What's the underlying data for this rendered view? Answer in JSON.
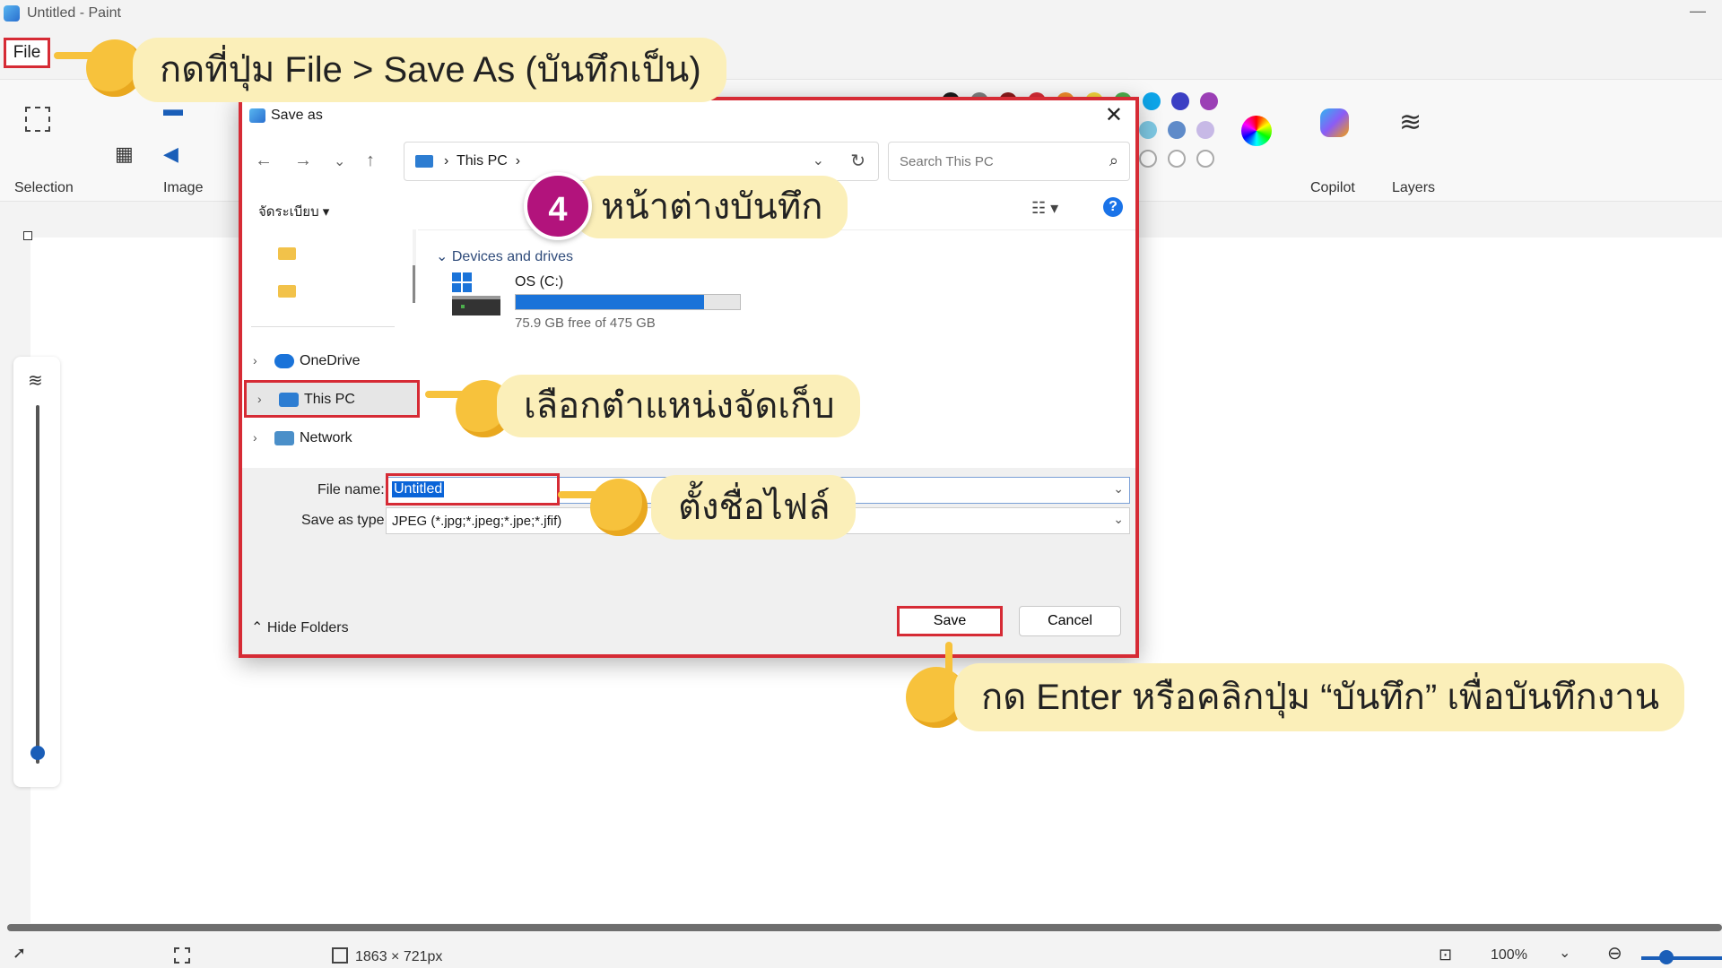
{
  "window": {
    "title": "Untitled - Paint",
    "minimize": "—"
  },
  "menu": {
    "file": "File"
  },
  "ribbon": {
    "groups": {
      "selection": "Selection",
      "image": "Image",
      "copilot": "Copilot",
      "layers": "Layers"
    },
    "swatches": [
      "#1a1a1a",
      "#7d7d7d",
      "#8a1a1a",
      "#d62b35",
      "#f08b2b",
      "#f3d33b",
      "#4cae4c",
      "#0ea5e9",
      "#3b3fc4",
      "#9b3fb5",
      "#7ec8e3",
      "#5f8bc9",
      "#c7b9e6"
    ]
  },
  "dialog": {
    "title": "Save as",
    "close": "✕",
    "address": {
      "location": "This PC",
      "sep": "›"
    },
    "search_placeholder": "Search This PC",
    "organize": "จัดระเบียบ ▾",
    "help": "?",
    "nav": {
      "onedrive": "OneDrive",
      "thispc": "This PC",
      "network": "Network"
    },
    "content": {
      "section": "Devices and drives",
      "drive_name": "OS (C:)",
      "drive_free": "75.9 GB free of 475 GB",
      "drive_used_fraction": 0.84
    },
    "fields": {
      "file_name_label": "File name:",
      "file_name_value": "Untitled",
      "save_type_label": "Save as type:",
      "save_type_value": "JPEG (*.jpg;*.jpeg;*.jpe;*.jfif)"
    },
    "hide_folders": "Hide Folders",
    "save": "Save",
    "cancel": "Cancel"
  },
  "status": {
    "canvas_size": "1863 × 721px",
    "zoom": "100%"
  },
  "annotations": {
    "step1": "กดที่ปุ่ม File > Save As (บันทึกเป็น)",
    "step_number": "4",
    "step4": "หน้าต่างบันทึก",
    "location": "เลือกตำแหน่งจัดเก็บ",
    "filename": "ตั้งชื่อไฟล์",
    "save": "กด Enter หรือคลิกปุ่ม “บันทึก” เพื่อบันทึกงาน"
  }
}
